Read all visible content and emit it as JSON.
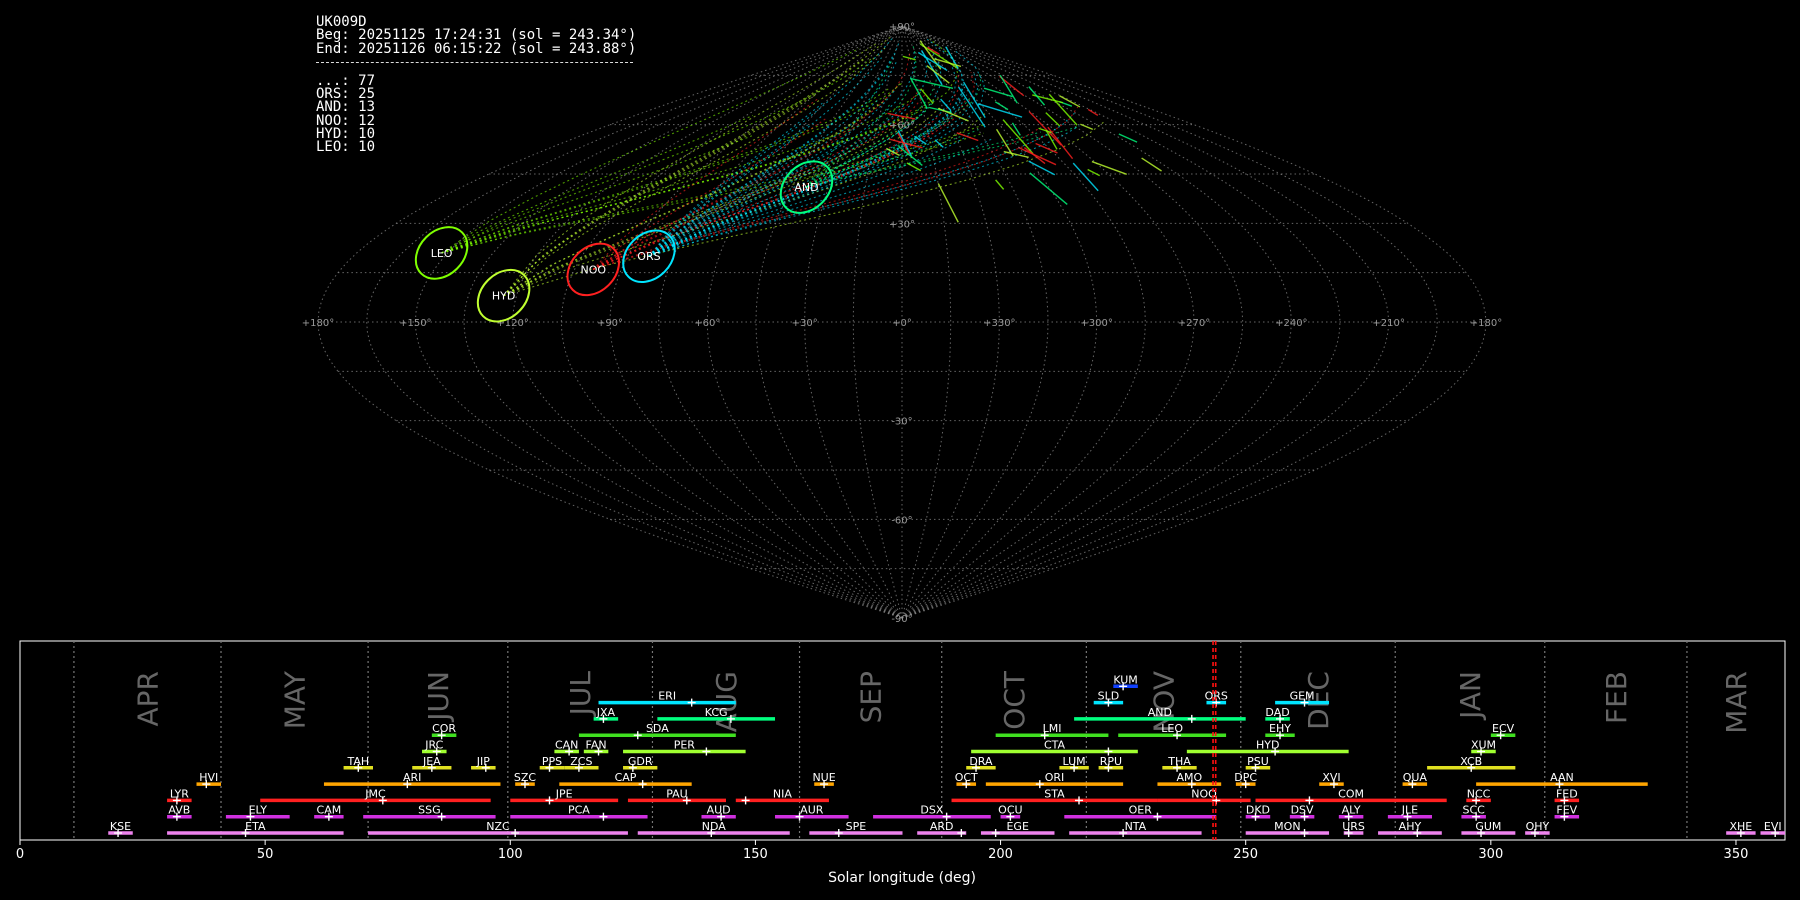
{
  "camera": {
    "station": "UK009D",
    "beg_line": "Beg: 20251125 17:24:31 (sol = 243.34°)",
    "end_line": "End: 20251126 06:15:22 (sol = 243.88°)",
    "counts": [
      {
        "label": "...: 77"
      },
      {
        "label": "ORS: 25"
      },
      {
        "label": "AND: 13"
      },
      {
        "label": "NOO: 12"
      },
      {
        "label": "HYD: 10"
      },
      {
        "label": "LEO: 10"
      }
    ]
  },
  "sky_map": {
    "projection": "sinusoidal",
    "ra_tick_labels": [
      {
        "ra": 180,
        "label": "+180°"
      },
      {
        "ra": 150,
        "label": "+150°"
      },
      {
        "ra": 120,
        "label": "+120°"
      },
      {
        "ra": 90,
        "label": "+90°"
      },
      {
        "ra": 60,
        "label": "+60°"
      },
      {
        "ra": 30,
        "label": "+30°"
      },
      {
        "ra": 0,
        "label": "+0°"
      },
      {
        "ra": -30,
        "label": "+330°"
      },
      {
        "ra": -60,
        "label": "+300°"
      },
      {
        "ra": -90,
        "label": "+270°"
      },
      {
        "ra": -120,
        "label": "+240°"
      },
      {
        "ra": -150,
        "label": "+210°"
      },
      {
        "ra": -180,
        "label": "+180°"
      }
    ],
    "dec_tick_labels": [
      {
        "dec": 90,
        "label": "+90°"
      },
      {
        "dec": 60,
        "label": "+60°"
      },
      {
        "dec": 30,
        "label": "+30°"
      },
      {
        "dec": -30,
        "label": "-30°"
      },
      {
        "dec": -60,
        "label": "-60°"
      },
      {
        "dec": -90,
        "label": "-90°"
      }
    ],
    "radiants": [
      {
        "code": "LEO",
        "ra": 152,
        "dec": 21,
        "color": "#7fff00"
      },
      {
        "code": "HYD",
        "ra": 124,
        "dec": 8,
        "color": "#c0ff30"
      },
      {
        "code": "NOO",
        "ra": 99,
        "dec": 16,
        "color": "#ff2020"
      },
      {
        "code": "ORS",
        "ra": 83,
        "dec": 20,
        "color": "#00e5ff"
      },
      {
        "code": "AND",
        "ra": 39,
        "dec": 41,
        "color": "#00ff7f"
      }
    ]
  },
  "chart_data": {
    "type": "timeline",
    "xlabel": "Solar longitude (deg)",
    "xlim": [
      0,
      360
    ],
    "x_ticks": [
      0,
      50,
      100,
      150,
      200,
      250,
      300,
      350
    ],
    "current_sol": [
      243.34,
      243.88
    ],
    "months": [
      {
        "label": "APR",
        "start": 11,
        "end": 41
      },
      {
        "label": "MAY",
        "start": 41,
        "end": 71
      },
      {
        "label": "JUN",
        "start": 71,
        "end": 99.5
      },
      {
        "label": "JUL",
        "start": 99.5,
        "end": 129
      },
      {
        "label": "AUG",
        "start": 129,
        "end": 159
      },
      {
        "label": "SEP",
        "start": 159,
        "end": 188
      },
      {
        "label": "OCT",
        "start": 188,
        "end": 217.5
      },
      {
        "label": "NOV",
        "start": 217.5,
        "end": 249
      },
      {
        "label": "DEC",
        "start": 249,
        "end": 280.5
      },
      {
        "label": "JAN",
        "start": 280.5,
        "end": 311
      },
      {
        "label": "FEB",
        "start": 311,
        "end": 340
      },
      {
        "label": "MAR",
        "start": 340,
        "end": 371
      }
    ],
    "showers": [
      {
        "code": "KUM",
        "row": 9,
        "start": 223,
        "end": 228,
        "peak": 225,
        "color": "#1040ff"
      },
      {
        "code": "ERI",
        "row": 8,
        "start": 118,
        "end": 146,
        "peak": 137,
        "color": "#00e5ff"
      },
      {
        "code": "SLD",
        "row": 8,
        "start": 219,
        "end": 225,
        "peak": 222,
        "color": "#00e5ff"
      },
      {
        "code": "ORS",
        "row": 8,
        "start": 242,
        "end": 246,
        "peak": 244,
        "color": "#00e5ff"
      },
      {
        "code": "GEM",
        "row": 8,
        "start": 256,
        "end": 267,
        "peak": 262,
        "color": "#00e5ff"
      },
      {
        "code": "JXA",
        "row": 7,
        "start": 117,
        "end": 122,
        "peak": 119,
        "color": "#00ff7f"
      },
      {
        "code": "KCG",
        "row": 7,
        "start": 130,
        "end": 154,
        "peak": 145,
        "color": "#00ff7f"
      },
      {
        "code": "AND",
        "row": 7,
        "start": 215,
        "end": 250,
        "peak": 239,
        "color": "#00ff7f"
      },
      {
        "code": "DAD",
        "row": 7,
        "start": 254,
        "end": 259,
        "peak": 257,
        "color": "#00ff7f"
      },
      {
        "code": "COR",
        "row": 6,
        "start": 84,
        "end": 89,
        "peak": 86,
        "color": "#40e020"
      },
      {
        "code": "SDA",
        "row": 6,
        "start": 114,
        "end": 146,
        "peak": 126,
        "color": "#40e020"
      },
      {
        "code": "LMI",
        "row": 6,
        "start": 199,
        "end": 222,
        "peak": 209,
        "color": "#40e020"
      },
      {
        "code": "LEO",
        "row": 6,
        "start": 224,
        "end": 246,
        "peak": 236,
        "color": "#40e020"
      },
      {
        "code": "EHY",
        "row": 6,
        "start": 254,
        "end": 260,
        "peak": 257,
        "color": "#40e020"
      },
      {
        "code": "ECV",
        "row": 6,
        "start": 300,
        "end": 305,
        "peak": 302,
        "color": "#40e020"
      },
      {
        "code": "JRC",
        "row": 5,
        "start": 82,
        "end": 87,
        "peak": 85,
        "color": "#a0ff30"
      },
      {
        "code": "CAN",
        "row": 5,
        "start": 109,
        "end": 114,
        "peak": 112,
        "color": "#a0ff30"
      },
      {
        "code": "FAN",
        "row": 5,
        "start": 115,
        "end": 120,
        "peak": 118,
        "color": "#a0ff30"
      },
      {
        "code": "PER",
        "row": 5,
        "start": 123,
        "end": 148,
        "peak": 140,
        "color": "#a0ff30"
      },
      {
        "code": "CTA",
        "row": 5,
        "start": 194,
        "end": 228,
        "peak": 222,
        "color": "#a0ff30"
      },
      {
        "code": "HYD",
        "row": 5,
        "start": 238,
        "end": 271,
        "peak": 256,
        "color": "#a0ff30"
      },
      {
        "code": "XUM",
        "row": 5,
        "start": 296,
        "end": 301,
        "peak": 298,
        "color": "#a0ff30"
      },
      {
        "code": "TAH",
        "row": 4,
        "start": 66,
        "end": 72,
        "peak": 69,
        "color": "#e0e020"
      },
      {
        "code": "JEA",
        "row": 4,
        "start": 80,
        "end": 88,
        "peak": 84,
        "color": "#e0e020"
      },
      {
        "code": "JIP",
        "row": 4,
        "start": 92,
        "end": 97,
        "peak": 95,
        "color": "#e0e020"
      },
      {
        "code": "PPS",
        "row": 4,
        "start": 106,
        "end": 111,
        "peak": 108,
        "color": "#e0e020"
      },
      {
        "code": "ZCS",
        "row": 4,
        "start": 111,
        "end": 118,
        "peak": 114,
        "color": "#e0e020"
      },
      {
        "code": "GDR",
        "row": 4,
        "start": 123,
        "end": 130,
        "peak": 125,
        "color": "#e0e020"
      },
      {
        "code": "DRA",
        "row": 4,
        "start": 193,
        "end": 199,
        "peak": 195,
        "color": "#e0e020"
      },
      {
        "code": "LUM",
        "row": 4,
        "start": 212,
        "end": 218,
        "peak": 215,
        "color": "#e0e020"
      },
      {
        "code": "RPU",
        "row": 4,
        "start": 220,
        "end": 225,
        "peak": 222,
        "color": "#e0e020"
      },
      {
        "code": "THA",
        "row": 4,
        "start": 233,
        "end": 240,
        "peak": 236,
        "color": "#e0e020"
      },
      {
        "code": "PSU",
        "row": 4,
        "start": 250,
        "end": 255,
        "peak": 252,
        "color": "#e0e020"
      },
      {
        "code": "XCB",
        "row": 4,
        "start": 287,
        "end": 305,
        "peak": 296,
        "color": "#e0e020"
      },
      {
        "code": "HVI",
        "row": 3,
        "start": 36,
        "end": 41,
        "peak": 38,
        "color": "#ffa500"
      },
      {
        "code": "ARI",
        "row": 3,
        "start": 62,
        "end": 98,
        "peak": 79,
        "color": "#ffa500"
      },
      {
        "code": "SZC",
        "row": 3,
        "start": 101,
        "end": 105,
        "peak": 103,
        "color": "#ffa500"
      },
      {
        "code": "CAP",
        "row": 3,
        "start": 110,
        "end": 137,
        "peak": 127,
        "color": "#ffa500"
      },
      {
        "code": "NUE",
        "row": 3,
        "start": 162,
        "end": 166,
        "peak": 164,
        "color": "#ffa500"
      },
      {
        "code": "OCT",
        "row": 3,
        "start": 191,
        "end": 195,
        "peak": 193,
        "color": "#ffa500"
      },
      {
        "code": "ORI",
        "row": 3,
        "start": 197,
        "end": 225,
        "peak": 208,
        "color": "#ffa500"
      },
      {
        "code": "AMO",
        "row": 3,
        "start": 232,
        "end": 245,
        "peak": 239,
        "color": "#ffa500"
      },
      {
        "code": "DPC",
        "row": 3,
        "start": 248,
        "end": 252,
        "peak": 250,
        "color": "#ffa500"
      },
      {
        "code": "XVI",
        "row": 3,
        "start": 265,
        "end": 270,
        "peak": 268,
        "color": "#ffa500"
      },
      {
        "code": "QUA",
        "row": 3,
        "start": 282,
        "end": 287,
        "peak": 284,
        "color": "#ffa500"
      },
      {
        "code": "AAN",
        "row": 3,
        "start": 297,
        "end": 332,
        "peak": 314,
        "color": "#ffa500"
      },
      {
        "code": "LYR",
        "row": 2,
        "start": 30,
        "end": 35,
        "peak": 32,
        "color": "#ff2020"
      },
      {
        "code": "JMC",
        "row": 2,
        "start": 49,
        "end": 96,
        "peak": 74,
        "color": "#ff2020"
      },
      {
        "code": "JPE",
        "row": 2,
        "start": 100,
        "end": 122,
        "peak": 108,
        "color": "#ff2020"
      },
      {
        "code": "PAU",
        "row": 2,
        "start": 124,
        "end": 144,
        "peak": 136,
        "color": "#ff2020"
      },
      {
        "code": "NIA",
        "row": 2,
        "start": 146,
        "end": 165,
        "peak": 148,
        "color": "#ff2020"
      },
      {
        "code": "STA",
        "row": 2,
        "start": 190,
        "end": 232,
        "peak": 216,
        "color": "#ff2020"
      },
      {
        "code": "NOO",
        "row": 2,
        "start": 232,
        "end": 251,
        "peak": 244,
        "color": "#ff2020"
      },
      {
        "code": "COM",
        "row": 2,
        "start": 252,
        "end": 291,
        "peak": 263,
        "color": "#ff2020"
      },
      {
        "code": "NCC",
        "row": 2,
        "start": 295,
        "end": 300,
        "peak": 297,
        "color": "#ff2020"
      },
      {
        "code": "FED",
        "row": 2,
        "start": 313,
        "end": 318,
        "peak": 315,
        "color": "#ff2020"
      },
      {
        "code": "AVB",
        "row": 1,
        "start": 30,
        "end": 35,
        "peak": 32,
        "color": "#d030e0"
      },
      {
        "code": "ELY",
        "row": 1,
        "start": 42,
        "end": 55,
        "peak": 47,
        "color": "#d030e0"
      },
      {
        "code": "CAM",
        "row": 1,
        "start": 60,
        "end": 66,
        "peak": 63,
        "color": "#d030e0"
      },
      {
        "code": "SSG",
        "row": 1,
        "start": 70,
        "end": 97,
        "peak": 86,
        "color": "#d030e0"
      },
      {
        "code": "PCA",
        "row": 1,
        "start": 100,
        "end": 128,
        "peak": 119,
        "color": "#d030e0"
      },
      {
        "code": "AUD",
        "row": 1,
        "start": 139,
        "end": 146,
        "peak": 143,
        "color": "#d030e0"
      },
      {
        "code": "AUR",
        "row": 1,
        "start": 154,
        "end": 169,
        "peak": 159,
        "color": "#d030e0"
      },
      {
        "code": "DSX",
        "row": 1,
        "start": 174,
        "end": 198,
        "peak": 189,
        "color": "#d030e0"
      },
      {
        "code": "OCU",
        "row": 1,
        "start": 200,
        "end": 204,
        "peak": 202,
        "color": "#d030e0"
      },
      {
        "code": "OER",
        "row": 1,
        "start": 213,
        "end": 244,
        "peak": 232,
        "color": "#d030e0"
      },
      {
        "code": "DKD",
        "row": 1,
        "start": 250,
        "end": 255,
        "peak": 252,
        "color": "#d030e0"
      },
      {
        "code": "DSV",
        "row": 1,
        "start": 259,
        "end": 264,
        "peak": 262,
        "color": "#d030e0"
      },
      {
        "code": "ALY",
        "row": 1,
        "start": 269,
        "end": 274,
        "peak": 271,
        "color": "#d030e0"
      },
      {
        "code": "JLE",
        "row": 1,
        "start": 279,
        "end": 288,
        "peak": 283,
        "color": "#d030e0"
      },
      {
        "code": "SCC",
        "row": 1,
        "start": 294,
        "end": 299,
        "peak": 297,
        "color": "#d030e0"
      },
      {
        "code": "FEV",
        "row": 1,
        "start": 313,
        "end": 318,
        "peak": 315,
        "color": "#d030e0"
      },
      {
        "code": "KSE",
        "row": 0,
        "start": 18,
        "end": 23,
        "peak": 20,
        "color": "#ee82ee"
      },
      {
        "code": "ETA",
        "row": 0,
        "start": 30,
        "end": 66,
        "peak": 46,
        "color": "#ee82ee"
      },
      {
        "code": "NZC",
        "row": 0,
        "start": 71,
        "end": 124,
        "peak": 101,
        "color": "#ee82ee"
      },
      {
        "code": "NDA",
        "row": 0,
        "start": 126,
        "end": 157,
        "peak": 141,
        "color": "#ee82ee"
      },
      {
        "code": "SPE",
        "row": 0,
        "start": 161,
        "end": 180,
        "peak": 167,
        "color": "#ee82ee"
      },
      {
        "code": "ARD",
        "row": 0,
        "start": 183,
        "end": 193,
        "peak": 192,
        "color": "#ee82ee"
      },
      {
        "code": "EGE",
        "row": 0,
        "start": 196,
        "end": 211,
        "peak": 199,
        "color": "#ee82ee"
      },
      {
        "code": "NTA",
        "row": 0,
        "start": 214,
        "end": 241,
        "peak": 225,
        "color": "#ee82ee"
      },
      {
        "code": "MON",
        "row": 0,
        "start": 250,
        "end": 267,
        "peak": 262,
        "color": "#ee82ee"
      },
      {
        "code": "URS",
        "row": 0,
        "start": 270,
        "end": 274,
        "peak": 271,
        "color": "#ee82ee"
      },
      {
        "code": "AHY",
        "row": 0,
        "start": 277,
        "end": 290,
        "peak": 285,
        "color": "#ee82ee"
      },
      {
        "code": "GUM",
        "row": 0,
        "start": 294,
        "end": 305,
        "peak": 298,
        "color": "#ee82ee"
      },
      {
        "code": "OHY",
        "row": 0,
        "start": 307,
        "end": 312,
        "peak": 309,
        "color": "#ee82ee"
      },
      {
        "code": "XHE",
        "row": 0,
        "start": 348,
        "end": 354,
        "peak": 351,
        "color": "#ee82ee"
      },
      {
        "code": "EVI",
        "row": 0,
        "start": 355,
        "end": 360,
        "peak": 358,
        "color": "#ee82ee"
      }
    ]
  }
}
